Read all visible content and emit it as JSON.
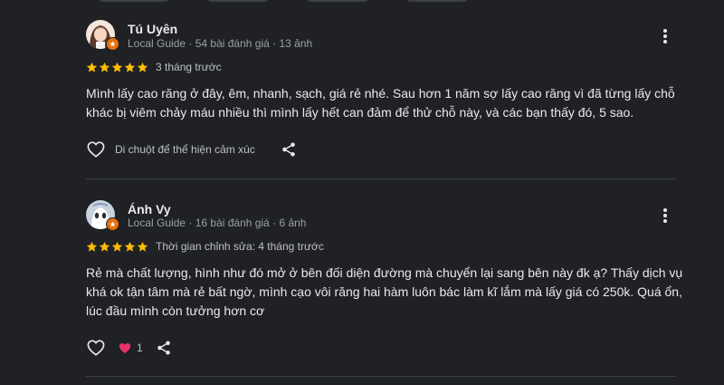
{
  "colors": {
    "background": "#202124",
    "star": "#fbbc04",
    "guide_badge": "#e8710a",
    "heart_filled": "#e8336a",
    "text": "#e8eaed",
    "muted": "#9aa0a6"
  },
  "reviews": [
    {
      "author": "Tú Uyên",
      "meta": "Local Guide · 54 bài đánh giá · 13 ảnh",
      "rating": 5,
      "date": "3 tháng trước",
      "text": "Mình lấy cao răng ở đây, êm, nhanh, sạch, giá rẻ nhé. Sau hơn 1 năm sợ lấy cao răng vì đã từng lấy chỗ khác bị viêm chảy máu nhiều thì mình lấy hết can đảm để thử chỗ này, và các bạn thấy đó, 5 sao.",
      "hover_hint": "Di chuột để thể hiện cảm xúc",
      "icons": [
        "heart-outline-icon",
        "share-icon",
        "more-vert-icon",
        "local-guide-badge-icon",
        "star-icon"
      ]
    },
    {
      "author": "Ánh Vy",
      "meta": "Local Guide · 16 bài đánh giá · 6 ảnh",
      "rating": 5,
      "date": "Thời gian chỉnh sửa: 4 tháng trước",
      "text": "Rẻ mà chất lượng, hình như đó mở ở bên đối diện đường mà chuyển lại sang bên này đk ạ? Thấy dịch vụ khá ok tận tâm mà rẻ bất ngờ, mình cạo vôi răng hai hàm luôn bác làm kĩ lắm mà lấy giá có 250k. Quá ổn, lúc đầu mình còn tưởng hơn cơ",
      "like_count": "1",
      "icons": [
        "heart-outline-icon",
        "heart-filled-icon",
        "share-icon",
        "more-vert-icon",
        "local-guide-badge-icon",
        "star-icon"
      ]
    }
  ]
}
